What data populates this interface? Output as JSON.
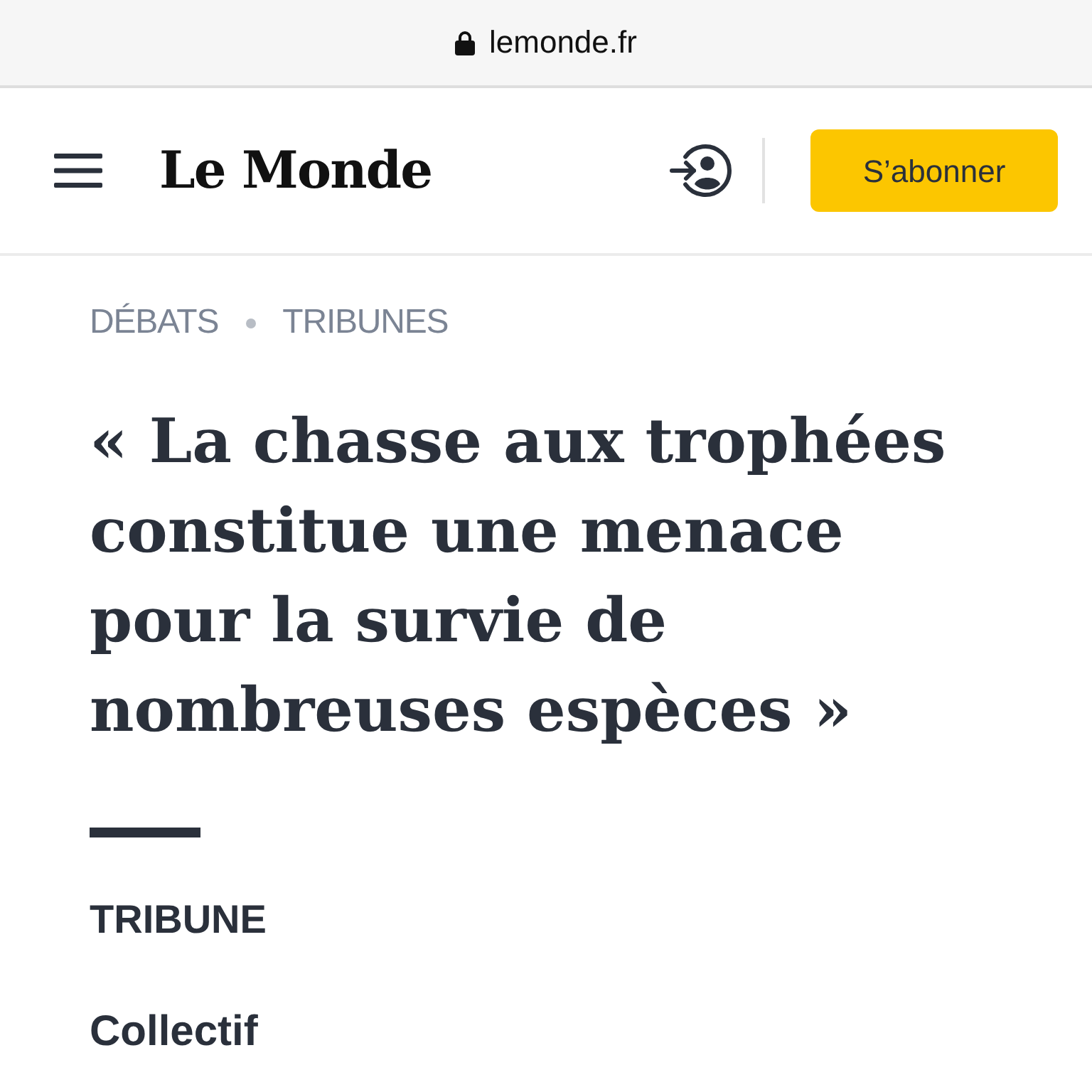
{
  "browser_bar": {
    "url": "lemonde.fr",
    "secure": true
  },
  "header": {
    "logo": "Le Monde",
    "subscribe_button": "S’abonner"
  },
  "breadcrumb": [
    "DÉBATS",
    "TRIBUNES"
  ],
  "article": {
    "title": "« La chasse aux trophées constitue une menace pour la survie de nombreuses espèces »",
    "label": "TRIBUNE",
    "author": "Collectif"
  }
}
